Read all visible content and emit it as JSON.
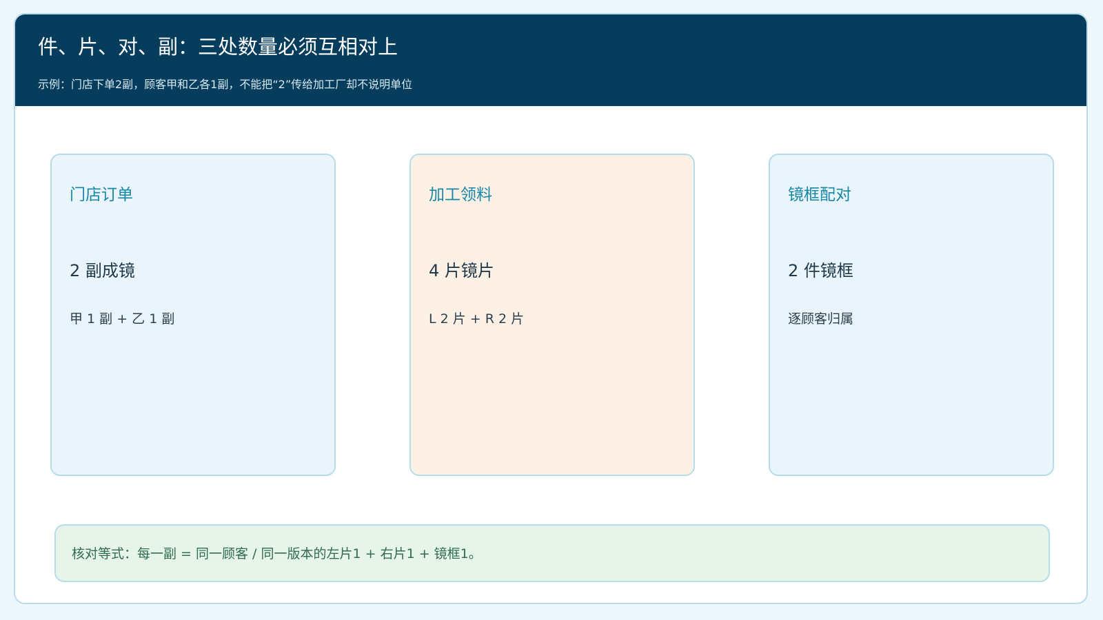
{
  "header": {
    "title": "件、片、对、副：三处数量必须互相对上",
    "subtitle": "示例：门店下单2副，顾客甲和乙各1副，不能把“2”传给加工厂却不说明单位"
  },
  "cards": [
    {
      "title": "门店订单",
      "main": "2 副成镜",
      "sub": "甲 1 副 + 乙 1 副"
    },
    {
      "title": "加工领料",
      "main": "4 片镜片",
      "sub": "L 2 片 + R 2 片"
    },
    {
      "title": "镜框配对",
      "main": "2 件镜框",
      "sub": "逐顾客归属"
    }
  ],
  "formula": {
    "text": "核对等式：每一副 = 同一顾客 / 同一版本的左片1 + 右片1 + 镜框1。"
  },
  "colors": {
    "header_bg": "#073d5c",
    "card_blue_bg": "#e9f5fb",
    "card_orange_bg": "#fdf0e5",
    "formula_bg": "#e6f4ea",
    "accent": "#1787a8"
  }
}
